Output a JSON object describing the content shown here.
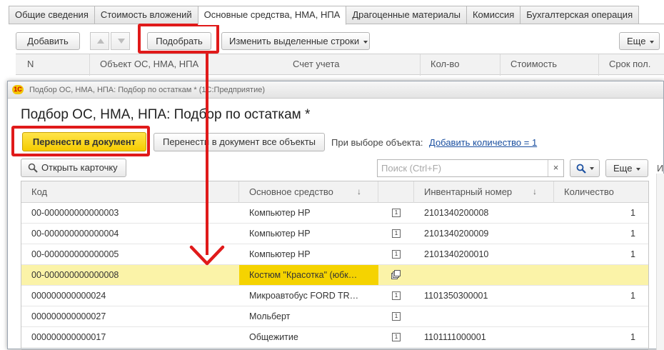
{
  "tabs": [
    {
      "label": "Общие сведения",
      "active": false
    },
    {
      "label": "Стоимость вложений",
      "active": false
    },
    {
      "label": "Основные средства, НМА, НПА",
      "active": true
    },
    {
      "label": "Драгоценные материалы",
      "active": false
    },
    {
      "label": "Комиссия",
      "active": false
    },
    {
      "label": "Бухгалтерская операция",
      "active": false
    }
  ],
  "toolbar": {
    "add_label": "Добавить",
    "pick_label": "Подобрать",
    "edit_rows_label": "Изменить выделенные строки",
    "more_label": "Еще"
  },
  "bg_table": {
    "columns": [
      "N",
      "Объект ОС, НМА, НПА",
      "Счет учета",
      "Кол-во",
      "Стоимость",
      "Срок пол."
    ]
  },
  "window": {
    "title": "Подбор ОС, НМА, НПА: Подбор по остаткам *  (1С:Предприятие)",
    "logo_text": "1С",
    "form_title": "Подбор ОС, НМА, НПА: Подбор по остаткам *",
    "transfer_label": "Перенести в документ",
    "transfer_all_label": "Перенести в документ все объекты",
    "on_select_label": "При выборе объекта:",
    "add_qty_link": "Добавить количество = 1",
    "open_card_label": "Открыть карточку",
    "search_placeholder": "Поиск (Ctrl+F)",
    "clear_symbol": "×",
    "more_label": "Еще",
    "side_label": "И"
  },
  "grid": {
    "columns": [
      "Код",
      "Основное средство",
      "Инвентарный номер",
      "Количество"
    ],
    "rows": [
      {
        "code": "00-000000000000003",
        "asset": "Компьютер HP",
        "kind": "single",
        "inv": "2101340200008",
        "qty": "1",
        "selected": false
      },
      {
        "code": "00-000000000000004",
        "asset": "Компьютер HP",
        "kind": "single",
        "inv": "2101340200009",
        "qty": "1",
        "selected": false
      },
      {
        "code": "00-000000000000005",
        "asset": "Компьютер HP",
        "kind": "single",
        "inv": "2101340200010",
        "qty": "1",
        "selected": false
      },
      {
        "code": "00-000000000000008",
        "asset": "Костюм \"Красотка\" (юбк…",
        "kind": "group",
        "inv": "",
        "qty": "",
        "selected": true
      },
      {
        "code": "000000000000024",
        "asset": "Микроавтобус FORD TR…",
        "kind": "single",
        "inv": "1101350300001",
        "qty": "1",
        "selected": false
      },
      {
        "code": "000000000000027",
        "asset": "Мольберт",
        "kind": "single",
        "inv": "",
        "qty": "",
        "selected": false
      },
      {
        "code": "000000000000017",
        "asset": "Общежитие",
        "kind": "single",
        "inv": "1101111000001",
        "qty": "1",
        "selected": false
      }
    ]
  },
  "colors": {
    "accent_yellow": "#f5cb00",
    "selected_row": "#fbf3a8",
    "annotation_red": "#e01a1a",
    "link_blue": "#1a4fa0"
  }
}
